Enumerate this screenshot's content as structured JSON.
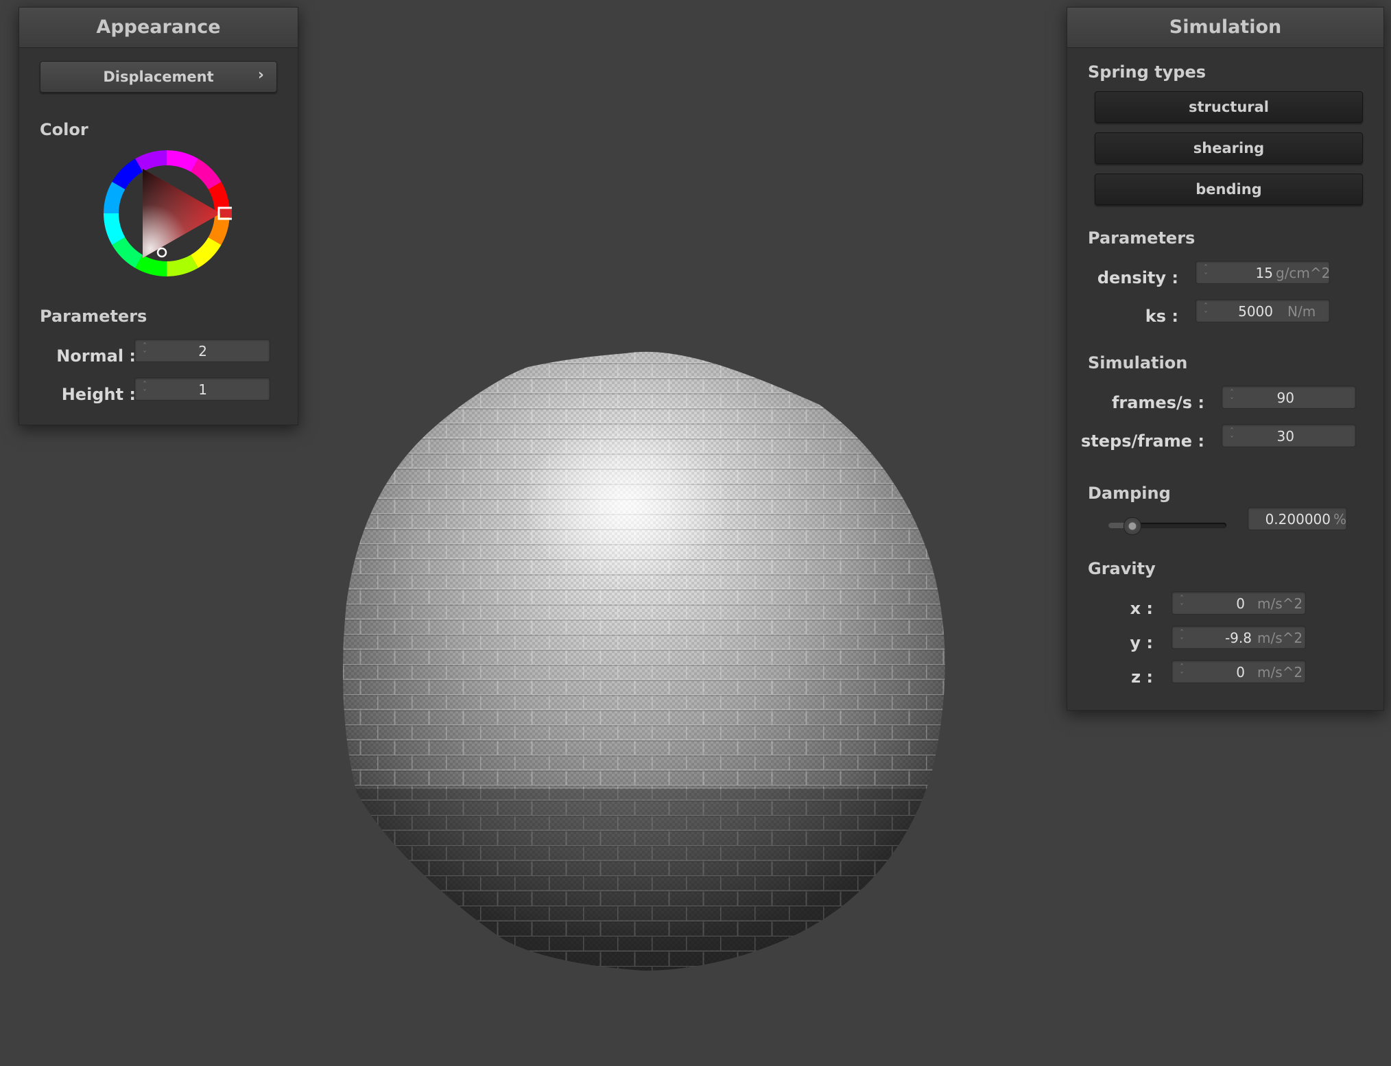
{
  "appearance": {
    "title": "Appearance",
    "displacement_button": "Displacement",
    "chevron": "›",
    "color_label": "Color",
    "color_wheel": {
      "selected_hue": "#d8262a",
      "icon": "color-wheel-icon"
    },
    "parameters_label": "Parameters",
    "normal_label": "Normal :",
    "normal_value": "2",
    "height_label": "Height :",
    "height_value": "1"
  },
  "simulation": {
    "title": "Simulation",
    "spring_types_label": "Spring types",
    "spring_buttons": [
      "structural",
      "shearing",
      "bending"
    ],
    "parameters_label": "Parameters",
    "density_label": "density :",
    "density_value": "15",
    "density_unit": "g/cm^2",
    "ks_label": "ks :",
    "ks_value": "5000",
    "ks_unit": "N/m",
    "simulation_label": "Simulation",
    "fps_label": "frames/s :",
    "fps_value": "90",
    "steps_label": "steps/frame :",
    "steps_value": "30",
    "damping_label": "Damping",
    "damping_slider_level": 0.2,
    "damping_value": "0.200000",
    "damping_unit": "%",
    "gravity_label": "Gravity",
    "gx_label": "x :",
    "gx_value": "0",
    "gy_label": "y :",
    "gy_value": "-9.8",
    "gz_label": "z :",
    "gz_value": "0",
    "gravity_unit": "m/s^2"
  },
  "colors": {
    "background": "#404040",
    "panel": "#333333",
    "accent": "#d8262a"
  }
}
